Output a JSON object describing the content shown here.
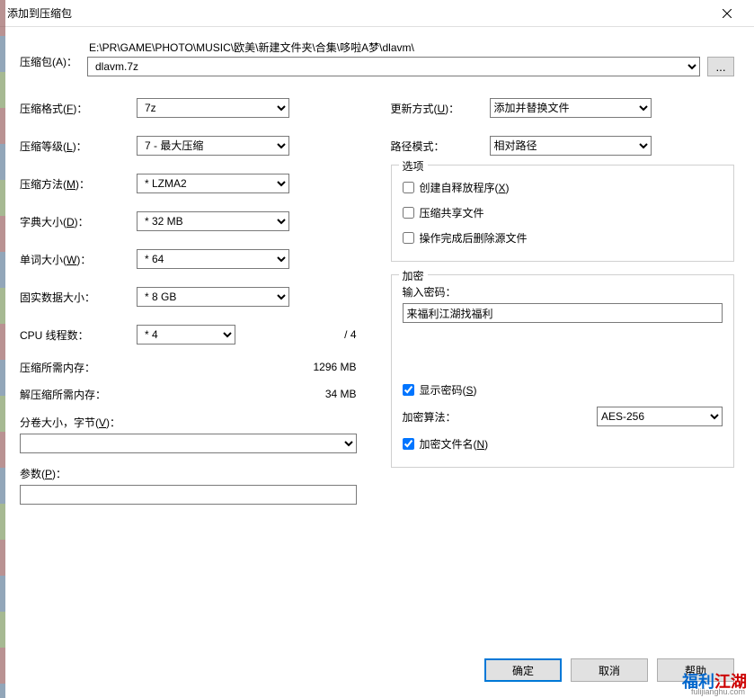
{
  "title": "添加到压缩包",
  "archive": {
    "label": "压缩包(A)：",
    "path": "E:\\PR\\GAME\\PHOTO\\MUSIC\\欧美\\新建文件夹\\合集\\哆啦A梦\\dlavm\\",
    "filename": "dlavm.7z",
    "browse": "..."
  },
  "left": {
    "format_label": "压缩格式(F)：",
    "format_value": "7z",
    "level_label": "压缩等级(L)：",
    "level_value": "7 - 最大压缩",
    "method_label": "压缩方法(M)：",
    "method_value": "* LZMA2",
    "dict_label": "字典大小(D)：",
    "dict_value": "* 32 MB",
    "word_label": "单词大小(W)：",
    "word_value": "* 64",
    "solid_label": "固实数据大小：",
    "solid_value": "* 8 GB",
    "cpu_label": "CPU 线程数：",
    "cpu_value": "* 4",
    "cpu_total": "/ 4",
    "comp_mem_label": "压缩所需内存：",
    "comp_mem_value": "1296 MB",
    "decomp_mem_label": "解压缩所需内存：",
    "decomp_mem_value": "34 MB",
    "split_label": "分卷大小，字节(V)：",
    "params_label": "参数(P)："
  },
  "right": {
    "update_label": "更新方式(U)：",
    "update_value": "添加并替换文件",
    "path_label": "路径模式：",
    "path_value": "相对路径",
    "options_legend": "选项",
    "sfx_label": "创建自释放程序(X)",
    "shared_label": "压缩共享文件",
    "delete_label": "操作完成后删除源文件",
    "encrypt_legend": "加密",
    "pw_label": "输入密码：",
    "pw_value": "来福利江湖找福利",
    "show_pw_label": "显示密码(S)",
    "enc_method_label": "加密算法：",
    "enc_method_value": "AES-256",
    "enc_names_label": "加密文件名(N)"
  },
  "footer": {
    "ok": "确定",
    "cancel": "取消",
    "help": "帮助"
  },
  "watermark": {
    "t1": "福利",
    "t2": "江湖",
    "sub": "fulijianghu.com"
  }
}
